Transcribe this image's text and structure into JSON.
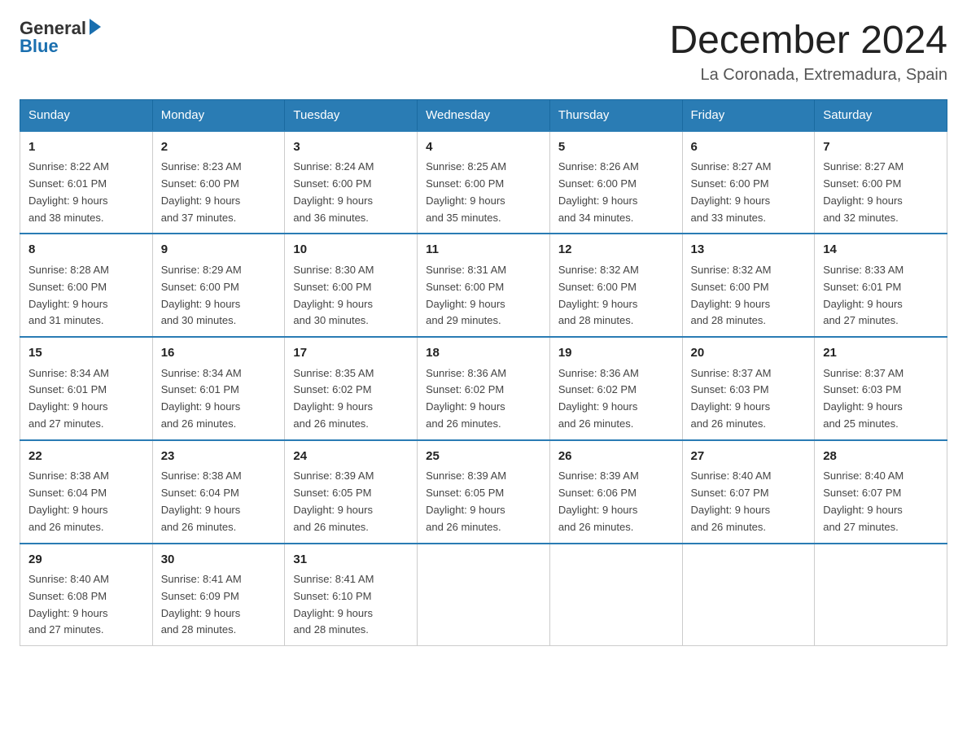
{
  "header": {
    "title": "December 2024",
    "subtitle": "La Coronada, Extremadura, Spain",
    "logo_line1": "General",
    "logo_line2": "Blue"
  },
  "days_of_week": [
    "Sunday",
    "Monday",
    "Tuesday",
    "Wednesday",
    "Thursday",
    "Friday",
    "Saturday"
  ],
  "weeks": [
    [
      {
        "day": "1",
        "sunrise": "8:22 AM",
        "sunset": "6:01 PM",
        "daylight": "9 hours and 38 minutes."
      },
      {
        "day": "2",
        "sunrise": "8:23 AM",
        "sunset": "6:00 PM",
        "daylight": "9 hours and 37 minutes."
      },
      {
        "day": "3",
        "sunrise": "8:24 AM",
        "sunset": "6:00 PM",
        "daylight": "9 hours and 36 minutes."
      },
      {
        "day": "4",
        "sunrise": "8:25 AM",
        "sunset": "6:00 PM",
        "daylight": "9 hours and 35 minutes."
      },
      {
        "day": "5",
        "sunrise": "8:26 AM",
        "sunset": "6:00 PM",
        "daylight": "9 hours and 34 minutes."
      },
      {
        "day": "6",
        "sunrise": "8:27 AM",
        "sunset": "6:00 PM",
        "daylight": "9 hours and 33 minutes."
      },
      {
        "day": "7",
        "sunrise": "8:27 AM",
        "sunset": "6:00 PM",
        "daylight": "9 hours and 32 minutes."
      }
    ],
    [
      {
        "day": "8",
        "sunrise": "8:28 AM",
        "sunset": "6:00 PM",
        "daylight": "9 hours and 31 minutes."
      },
      {
        "day": "9",
        "sunrise": "8:29 AM",
        "sunset": "6:00 PM",
        "daylight": "9 hours and 30 minutes."
      },
      {
        "day": "10",
        "sunrise": "8:30 AM",
        "sunset": "6:00 PM",
        "daylight": "9 hours and 30 minutes."
      },
      {
        "day": "11",
        "sunrise": "8:31 AM",
        "sunset": "6:00 PM",
        "daylight": "9 hours and 29 minutes."
      },
      {
        "day": "12",
        "sunrise": "8:32 AM",
        "sunset": "6:00 PM",
        "daylight": "9 hours and 28 minutes."
      },
      {
        "day": "13",
        "sunrise": "8:32 AM",
        "sunset": "6:00 PM",
        "daylight": "9 hours and 28 minutes."
      },
      {
        "day": "14",
        "sunrise": "8:33 AM",
        "sunset": "6:01 PM",
        "daylight": "9 hours and 27 minutes."
      }
    ],
    [
      {
        "day": "15",
        "sunrise": "8:34 AM",
        "sunset": "6:01 PM",
        "daylight": "9 hours and 27 minutes."
      },
      {
        "day": "16",
        "sunrise": "8:34 AM",
        "sunset": "6:01 PM",
        "daylight": "9 hours and 26 minutes."
      },
      {
        "day": "17",
        "sunrise": "8:35 AM",
        "sunset": "6:02 PM",
        "daylight": "9 hours and 26 minutes."
      },
      {
        "day": "18",
        "sunrise": "8:36 AM",
        "sunset": "6:02 PM",
        "daylight": "9 hours and 26 minutes."
      },
      {
        "day": "19",
        "sunrise": "8:36 AM",
        "sunset": "6:02 PM",
        "daylight": "9 hours and 26 minutes."
      },
      {
        "day": "20",
        "sunrise": "8:37 AM",
        "sunset": "6:03 PM",
        "daylight": "9 hours and 26 minutes."
      },
      {
        "day": "21",
        "sunrise": "8:37 AM",
        "sunset": "6:03 PM",
        "daylight": "9 hours and 25 minutes."
      }
    ],
    [
      {
        "day": "22",
        "sunrise": "8:38 AM",
        "sunset": "6:04 PM",
        "daylight": "9 hours and 26 minutes."
      },
      {
        "day": "23",
        "sunrise": "8:38 AM",
        "sunset": "6:04 PM",
        "daylight": "9 hours and 26 minutes."
      },
      {
        "day": "24",
        "sunrise": "8:39 AM",
        "sunset": "6:05 PM",
        "daylight": "9 hours and 26 minutes."
      },
      {
        "day": "25",
        "sunrise": "8:39 AM",
        "sunset": "6:05 PM",
        "daylight": "9 hours and 26 minutes."
      },
      {
        "day": "26",
        "sunrise": "8:39 AM",
        "sunset": "6:06 PM",
        "daylight": "9 hours and 26 minutes."
      },
      {
        "day": "27",
        "sunrise": "8:40 AM",
        "sunset": "6:07 PM",
        "daylight": "9 hours and 26 minutes."
      },
      {
        "day": "28",
        "sunrise": "8:40 AM",
        "sunset": "6:07 PM",
        "daylight": "9 hours and 27 minutes."
      }
    ],
    [
      {
        "day": "29",
        "sunrise": "8:40 AM",
        "sunset": "6:08 PM",
        "daylight": "9 hours and 27 minutes."
      },
      {
        "day": "30",
        "sunrise": "8:41 AM",
        "sunset": "6:09 PM",
        "daylight": "9 hours and 28 minutes."
      },
      {
        "day": "31",
        "sunrise": "8:41 AM",
        "sunset": "6:10 PM",
        "daylight": "9 hours and 28 minutes."
      },
      null,
      null,
      null,
      null
    ]
  ],
  "labels": {
    "sunrise": "Sunrise:",
    "sunset": "Sunset:",
    "daylight": "Daylight:"
  }
}
